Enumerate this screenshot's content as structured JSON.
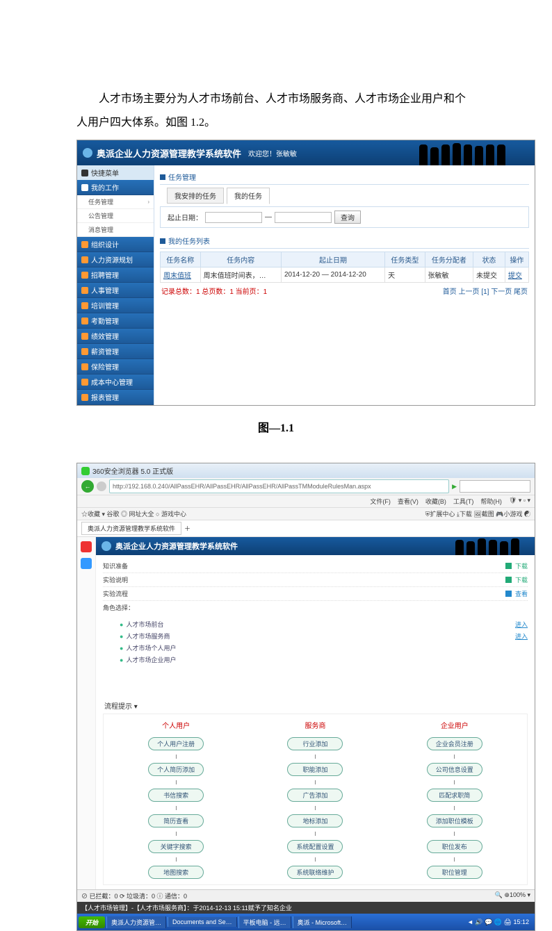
{
  "paragraph": "人才市场主要分为人才市场前台、人才市场服务商、人才市场企业用户和个人用户四大体系。如图 1.2。",
  "caption": "图—1.1",
  "shot1": {
    "app_title": "奥派企业人力资源管理教学系统软件",
    "welcome": "欢迎您！张敏敏",
    "quick_menu": "快捷菜单",
    "sidebar": {
      "active": "我的工作",
      "subs": [
        "任务管理",
        "公告管理",
        "消息管理"
      ],
      "items": [
        "组织设计",
        "人力资源规划",
        "招聘管理",
        "人事管理",
        "培训管理",
        "考勤管理",
        "绩效管理",
        "薪资管理",
        "保险管理",
        "成本中心管理",
        "报表管理"
      ]
    },
    "section1": "任务管理",
    "tabs": {
      "t1": "我安排的任务",
      "t2": "我的任务"
    },
    "filter_label": "起止日期：",
    "sep": "—",
    "search_btn": "查询",
    "section2": "我的任务列表",
    "headers": {
      "c1": "任务名称",
      "c2": "任务内容",
      "c3": "起止日期",
      "c4": "任务类型",
      "c5": "任务分配者",
      "c6": "状态",
      "c7": "操作"
    },
    "row": {
      "name": "周末值班",
      "content": "周末值班时间表，…",
      "date": "2014-12-20 — 2014-12-20",
      "type": "天",
      "assigner": "张敏敏",
      "status": "未提交",
      "op": "提交"
    },
    "pager_left": "记录总数：1  总页数：1  当前页：1",
    "pager_right": "首页 上一页 [1] 下一页 尾页"
  },
  "shot2": {
    "ie_title": "360安全浏览器 5.0 正式版",
    "url": "http://192.168.0.240/AllPassEHR/AllPassEHR/AllPassEHR/AllPassTMModuleRulesMan.aspx",
    "menu": [
      "文件(F)",
      "查看(V)",
      "收藏(B)",
      "工具(T)",
      "帮助(H)"
    ],
    "fav_left": "☆收藏 ▾  谷歌  ◎ 网址大全  ○ 游戏中心",
    "fav_right": "⛨扩展中心  ⤓下载  🖼截图  🎮小游戏  ☯",
    "tab1": "奥派人力资源管理教学系统软件",
    "app_title": "奥派企业人力资源管理教学系统软件",
    "rows": {
      "r1": {
        "label": "知识准备",
        "act": "下载"
      },
      "r2": {
        "label": "实验说明",
        "act": "下载"
      },
      "r3": {
        "label": "实验流程",
        "act": "查看"
      }
    },
    "role_label": "角色选择：",
    "roles": [
      "人才市场前台",
      "人才市场服务商",
      "人才市场个人用户",
      "人才市场企业用户"
    ],
    "enter": "进入",
    "flow_label": "流程提示 ▾",
    "flow": {
      "col1": {
        "title": "个人用户",
        "nodes": [
          "个人用户注册",
          "个人简历添加",
          "书信搜索",
          "简历查看",
          "关键字搜索",
          "地图搜索"
        ]
      },
      "col2": {
        "title": "服务商",
        "nodes": [
          "行业添加",
          "职能添加",
          "广告添加",
          "地标添加",
          "系统配置设置",
          "系统联络维护"
        ]
      },
      "col3": {
        "title": "企业用户",
        "nodes": [
          "企业会员注册",
          "公司信息设置",
          "匹配求职简",
          "添加职位模板",
          "职位发布",
          "职位管理"
        ]
      }
    },
    "status_left": "⊘ 已拦截：0  ⟳ 垃圾清：0  ⓘ 通信：0",
    "status_right": "🔍 ⊕100% ▾ ",
    "task_msg": "【人才市场管理】-【人才市场服务商】：于2014-12-13 15:11赋予了知名企业",
    "taskbar": {
      "start": "开始",
      "items": [
        "奥派人力资源管…",
        "Documents and Se…",
        "平板电脑 - 远…",
        "奥派 - Microsoft…"
      ],
      "tray": "◄ 🔊 💬 🌐 🖨 15:12"
    }
  }
}
